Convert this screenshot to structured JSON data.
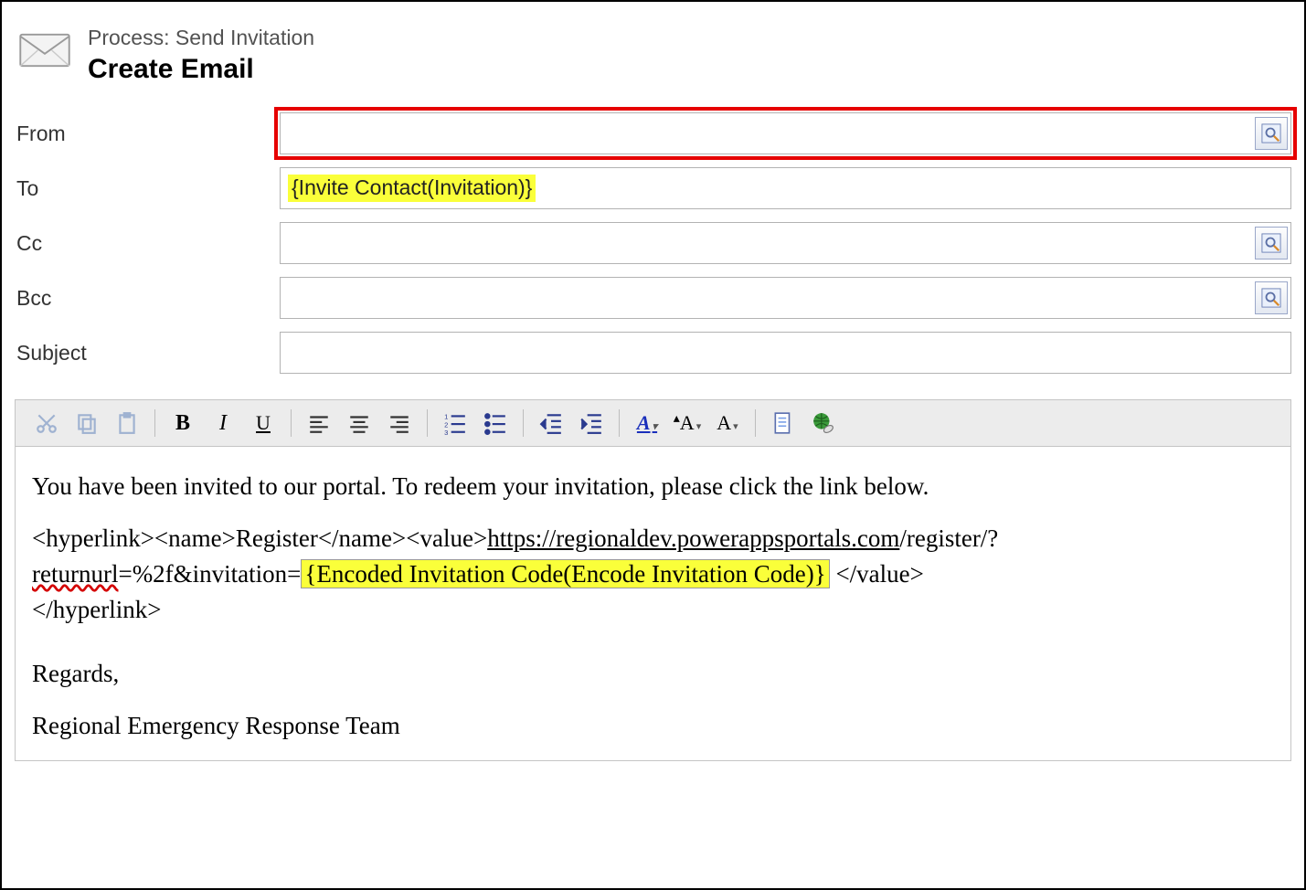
{
  "header": {
    "process_label": "Process: Send Invitation",
    "title": "Create Email"
  },
  "fields": {
    "from": {
      "label": "From",
      "value": ""
    },
    "to": {
      "label": "To",
      "value": "{Invite Contact(Invitation)}"
    },
    "cc": {
      "label": "Cc",
      "value": ""
    },
    "bcc": {
      "label": "Bcc",
      "value": ""
    },
    "subject": {
      "label": "Subject",
      "value": ""
    }
  },
  "toolbar": {
    "bold": "B",
    "italic": "I",
    "underline": "U",
    "font_a1": "A",
    "font_a2": "A",
    "font_a3": "A"
  },
  "editor": {
    "intro": "You have been invited to our portal. To redeem your invitation, please click the link below.",
    "tag_open": "<hyperlink><name>Register</name><value>",
    "url_part1": "https://regionaldev.powerappsportals.com",
    "url_part2": "/register/?",
    "returnurl_word": "returnurl",
    "url_part3": "=%2f&invitation=",
    "token": "{Encoded Invitation Code(Encode Invitation Code)}",
    "tag_close1": " </value>",
    "tag_close2": "</hyperlink>",
    "regards": "Regards,",
    "signature": "Regional Emergency Response Team"
  }
}
